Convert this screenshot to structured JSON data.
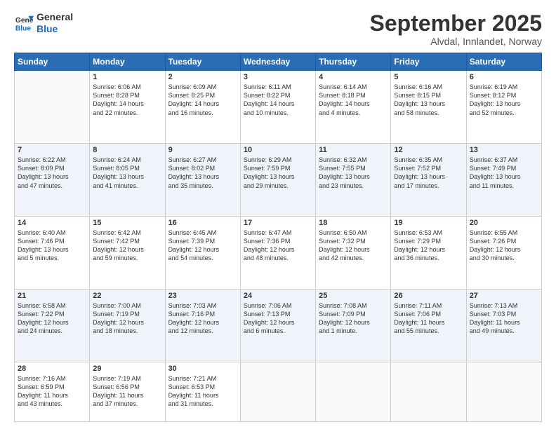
{
  "logo": {
    "line1": "General",
    "line2": "Blue"
  },
  "title": "September 2025",
  "location": "Alvdal, Innlandet, Norway",
  "weekdays": [
    "Sunday",
    "Monday",
    "Tuesday",
    "Wednesday",
    "Thursday",
    "Friday",
    "Saturday"
  ],
  "weeks": [
    [
      {
        "day": "",
        "content": ""
      },
      {
        "day": "1",
        "content": "Sunrise: 6:06 AM\nSunset: 8:28 PM\nDaylight: 14 hours\nand 22 minutes."
      },
      {
        "day": "2",
        "content": "Sunrise: 6:09 AM\nSunset: 8:25 PM\nDaylight: 14 hours\nand 16 minutes."
      },
      {
        "day": "3",
        "content": "Sunrise: 6:11 AM\nSunset: 8:22 PM\nDaylight: 14 hours\nand 10 minutes."
      },
      {
        "day": "4",
        "content": "Sunrise: 6:14 AM\nSunset: 8:18 PM\nDaylight: 14 hours\nand 4 minutes."
      },
      {
        "day": "5",
        "content": "Sunrise: 6:16 AM\nSunset: 8:15 PM\nDaylight: 13 hours\nand 58 minutes."
      },
      {
        "day": "6",
        "content": "Sunrise: 6:19 AM\nSunset: 8:12 PM\nDaylight: 13 hours\nand 52 minutes."
      }
    ],
    [
      {
        "day": "7",
        "content": "Sunrise: 6:22 AM\nSunset: 8:09 PM\nDaylight: 13 hours\nand 47 minutes."
      },
      {
        "day": "8",
        "content": "Sunrise: 6:24 AM\nSunset: 8:05 PM\nDaylight: 13 hours\nand 41 minutes."
      },
      {
        "day": "9",
        "content": "Sunrise: 6:27 AM\nSunset: 8:02 PM\nDaylight: 13 hours\nand 35 minutes."
      },
      {
        "day": "10",
        "content": "Sunrise: 6:29 AM\nSunset: 7:59 PM\nDaylight: 13 hours\nand 29 minutes."
      },
      {
        "day": "11",
        "content": "Sunrise: 6:32 AM\nSunset: 7:55 PM\nDaylight: 13 hours\nand 23 minutes."
      },
      {
        "day": "12",
        "content": "Sunrise: 6:35 AM\nSunset: 7:52 PM\nDaylight: 13 hours\nand 17 minutes."
      },
      {
        "day": "13",
        "content": "Sunrise: 6:37 AM\nSunset: 7:49 PM\nDaylight: 13 hours\nand 11 minutes."
      }
    ],
    [
      {
        "day": "14",
        "content": "Sunrise: 6:40 AM\nSunset: 7:46 PM\nDaylight: 13 hours\nand 5 minutes."
      },
      {
        "day": "15",
        "content": "Sunrise: 6:42 AM\nSunset: 7:42 PM\nDaylight: 12 hours\nand 59 minutes."
      },
      {
        "day": "16",
        "content": "Sunrise: 6:45 AM\nSunset: 7:39 PM\nDaylight: 12 hours\nand 54 minutes."
      },
      {
        "day": "17",
        "content": "Sunrise: 6:47 AM\nSunset: 7:36 PM\nDaylight: 12 hours\nand 48 minutes."
      },
      {
        "day": "18",
        "content": "Sunrise: 6:50 AM\nSunset: 7:32 PM\nDaylight: 12 hours\nand 42 minutes."
      },
      {
        "day": "19",
        "content": "Sunrise: 6:53 AM\nSunset: 7:29 PM\nDaylight: 12 hours\nand 36 minutes."
      },
      {
        "day": "20",
        "content": "Sunrise: 6:55 AM\nSunset: 7:26 PM\nDaylight: 12 hours\nand 30 minutes."
      }
    ],
    [
      {
        "day": "21",
        "content": "Sunrise: 6:58 AM\nSunset: 7:22 PM\nDaylight: 12 hours\nand 24 minutes."
      },
      {
        "day": "22",
        "content": "Sunrise: 7:00 AM\nSunset: 7:19 PM\nDaylight: 12 hours\nand 18 minutes."
      },
      {
        "day": "23",
        "content": "Sunrise: 7:03 AM\nSunset: 7:16 PM\nDaylight: 12 hours\nand 12 minutes."
      },
      {
        "day": "24",
        "content": "Sunrise: 7:06 AM\nSunset: 7:13 PM\nDaylight: 12 hours\nand 6 minutes."
      },
      {
        "day": "25",
        "content": "Sunrise: 7:08 AM\nSunset: 7:09 PM\nDaylight: 12 hours\nand 1 minute."
      },
      {
        "day": "26",
        "content": "Sunrise: 7:11 AM\nSunset: 7:06 PM\nDaylight: 11 hours\nand 55 minutes."
      },
      {
        "day": "27",
        "content": "Sunrise: 7:13 AM\nSunset: 7:03 PM\nDaylight: 11 hours\nand 49 minutes."
      }
    ],
    [
      {
        "day": "28",
        "content": "Sunrise: 7:16 AM\nSunset: 6:59 PM\nDaylight: 11 hours\nand 43 minutes."
      },
      {
        "day": "29",
        "content": "Sunrise: 7:19 AM\nSunset: 6:56 PM\nDaylight: 11 hours\nand 37 minutes."
      },
      {
        "day": "30",
        "content": "Sunrise: 7:21 AM\nSunset: 6:53 PM\nDaylight: 11 hours\nand 31 minutes."
      },
      {
        "day": "",
        "content": ""
      },
      {
        "day": "",
        "content": ""
      },
      {
        "day": "",
        "content": ""
      },
      {
        "day": "",
        "content": ""
      }
    ]
  ]
}
